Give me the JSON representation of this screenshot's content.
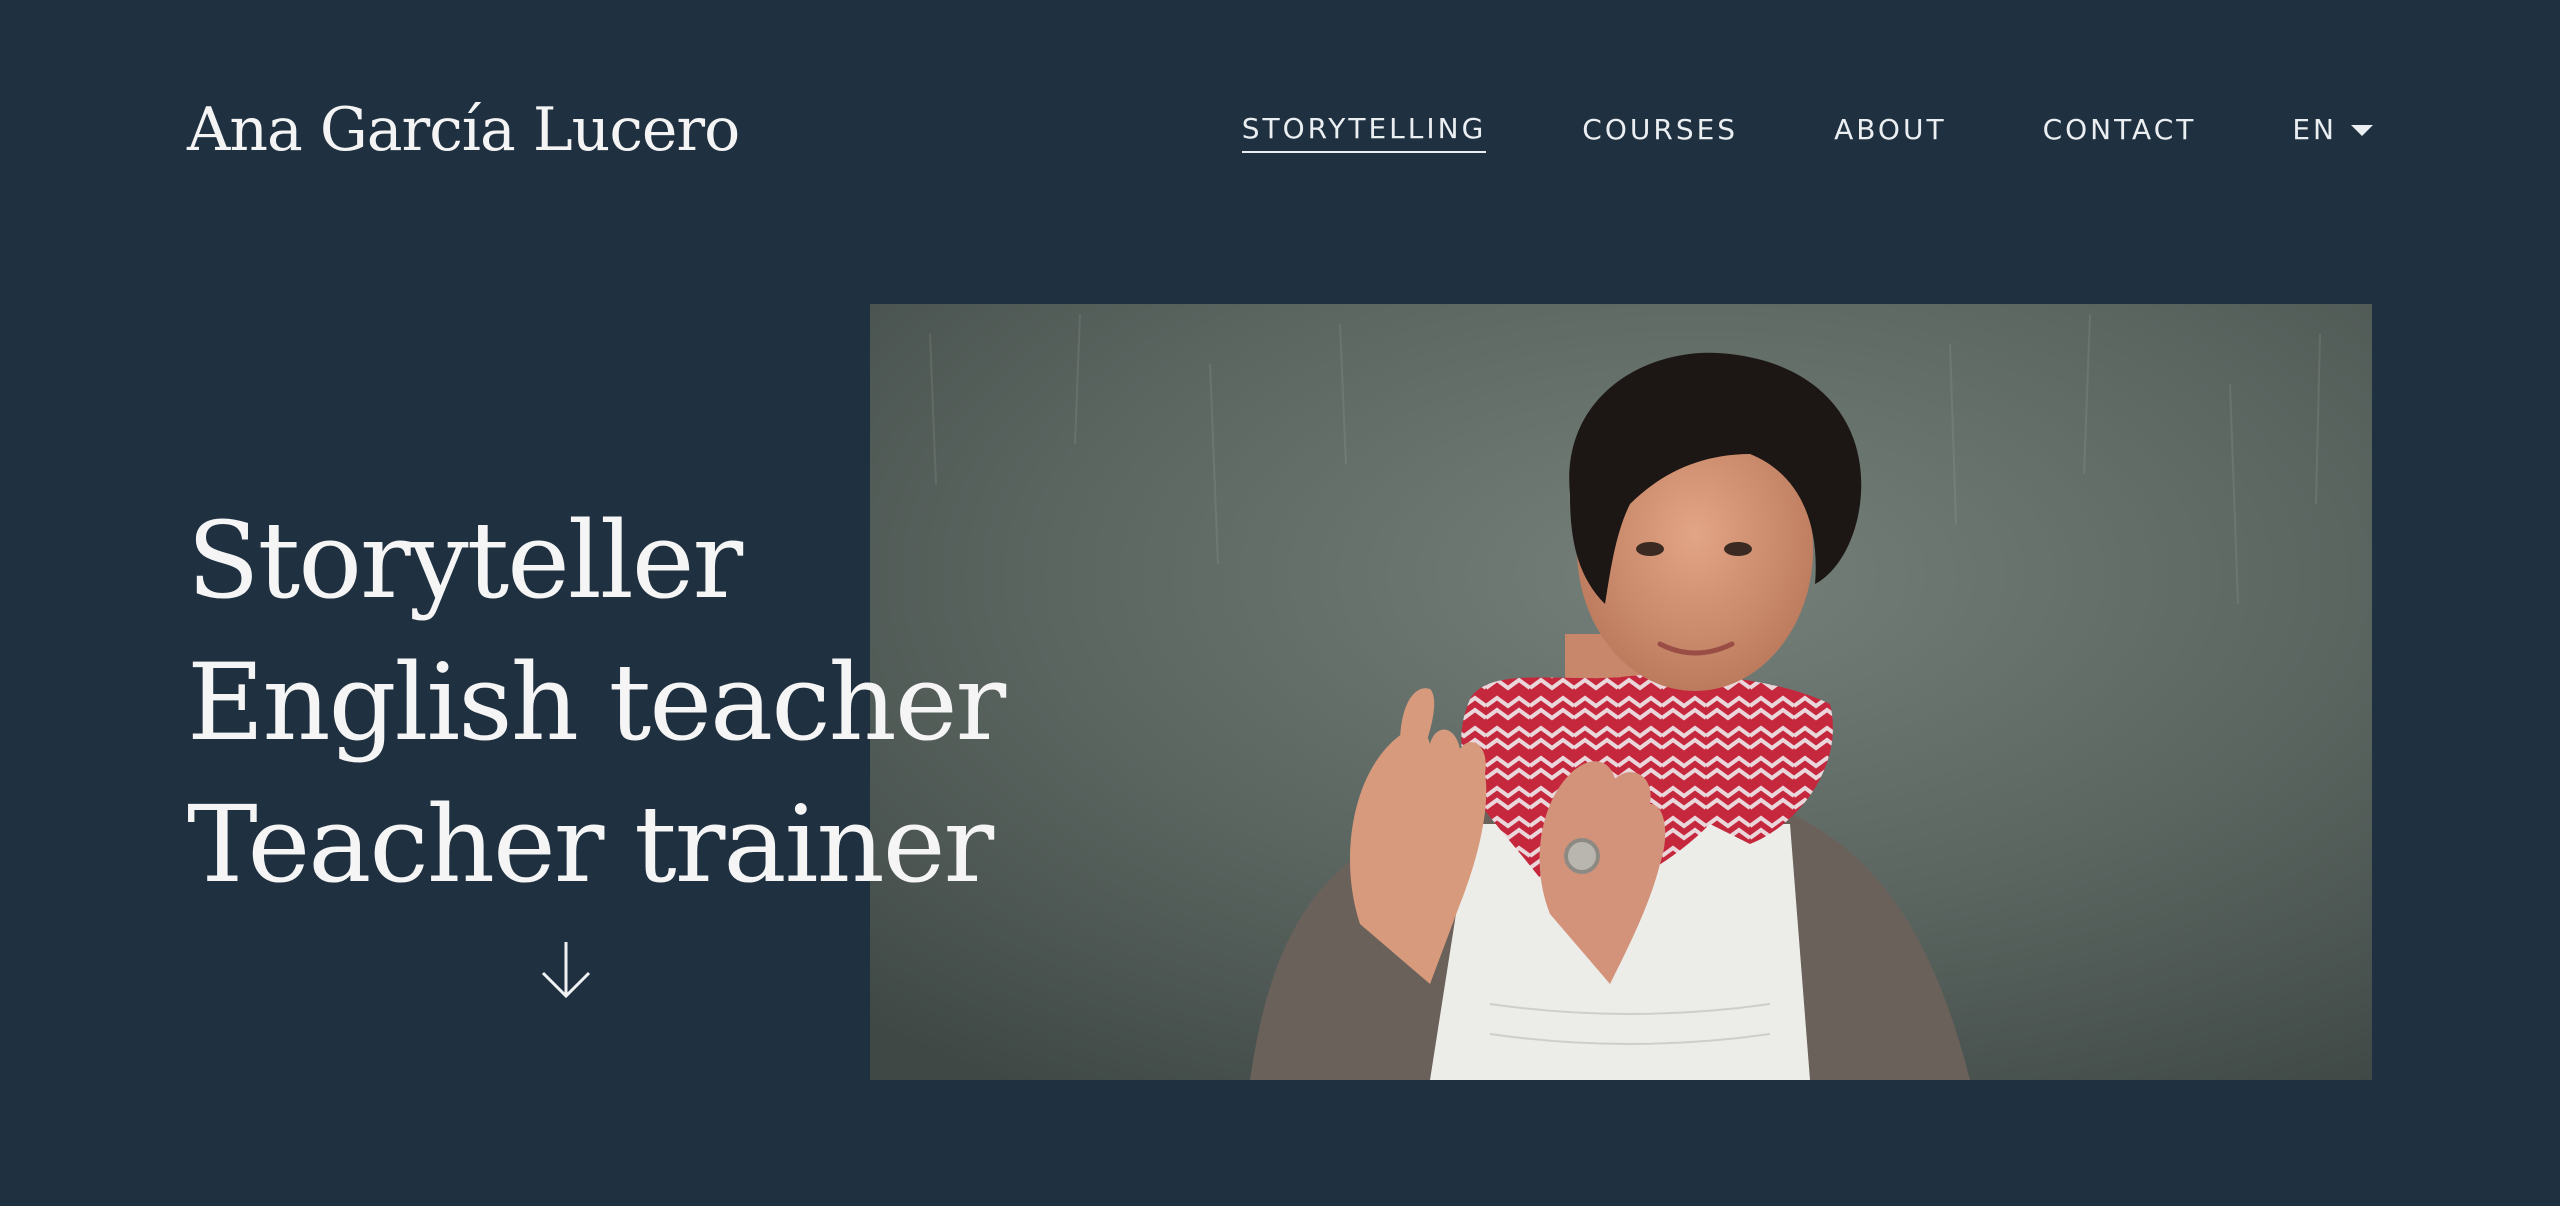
{
  "site": {
    "brand": "Ana García Lucero"
  },
  "nav": {
    "items": [
      {
        "label": "STORYTELLING",
        "active": true
      },
      {
        "label": "COURSES",
        "active": false
      },
      {
        "label": "ABOUT",
        "active": false
      },
      {
        "label": "CONTACT",
        "active": false
      }
    ],
    "language": "EN",
    "language_icon": "caret-down-icon"
  },
  "hero": {
    "headlines": [
      "Storyteller",
      "English teacher",
      "Teacher trainer"
    ],
    "scroll_icon": "arrow-down-icon"
  },
  "colors": {
    "background": "#1f3040",
    "text": "#f5f5f5",
    "scarf_red": "#c5283d"
  }
}
